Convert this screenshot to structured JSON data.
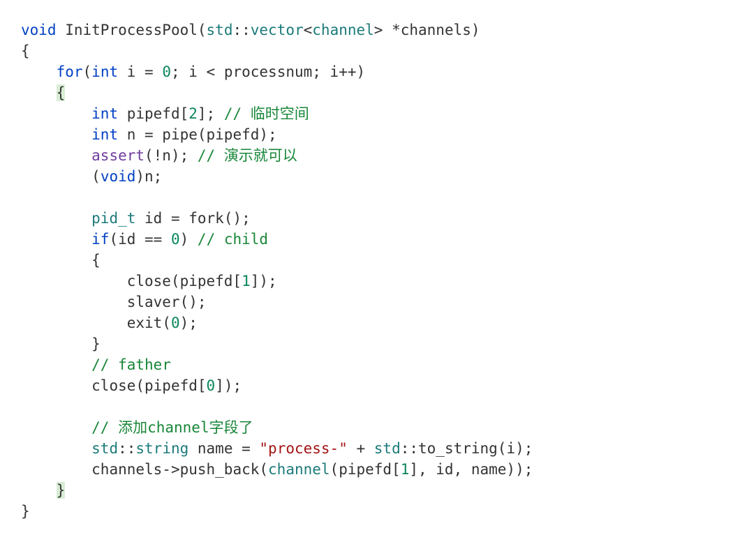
{
  "code": {
    "decl_void": "void",
    "decl_fn": " InitProcessPool",
    "decl_open": "(",
    "decl_std": "std",
    "decl_coloncolon1": "::",
    "decl_vector": "vector",
    "decl_lt": "<",
    "decl_channel": "channel",
    "decl_gt": ">",
    "decl_ptr": " *channels",
    "decl_close": ")",
    "brace_open_fn": "{",
    "for_kw": "for",
    "for_open": "(",
    "for_int": "int",
    "for_decl": " i = ",
    "for_zero": "0",
    "for_cond": "; i < processnum; i++",
    "for_close": ")",
    "brace_open_for": "{",
    "pipefd_int": "int",
    "pipefd_decl": " pipefd[",
    "pipefd_size": "2",
    "pipefd_end": "]; ",
    "pipefd_cmt": "// 临时空间",
    "npipe_int": "int",
    "npipe_rest": " n = pipe(pipefd);",
    "assert_fn": "assert",
    "assert_args": "(!n); ",
    "assert_cmt": "// 演示就可以",
    "castvoid_open": "(",
    "castvoid_kw": "void",
    "castvoid_rest": ")n;",
    "blank": "",
    "pidt": "pid_t",
    "pid_rest": " id = fork();",
    "if_kw": "if",
    "if_open": "(id == ",
    "if_zero": "0",
    "if_close": ") ",
    "if_cmt": "// child",
    "brace_open_if": "{",
    "child_close": "close(pipefd[",
    "child_close_idx": "1",
    "child_close_end": "]);",
    "child_slaver": "slaver();",
    "child_exit": "exit(",
    "child_exit_zero": "0",
    "child_exit_end": ");",
    "brace_close_if": "}",
    "father_cmt": "// father",
    "father_close": "close(pipefd[",
    "father_close_idx": "0",
    "father_close_end": "]);",
    "addch_cmt": "// 添加channel字段了",
    "name_std": "std",
    "name_cc": "::",
    "name_string": "string",
    "name_eq": " name = ",
    "name_str": "\"process-\"",
    "name_plus": " + ",
    "name_std2": "std",
    "name_cc2": "::",
    "name_tostr": "to_string(i);",
    "push_pre": "channels->push_back(",
    "push_channel": "channel",
    "push_open": "(pipefd[",
    "push_idx": "1",
    "push_rest": "], id, name));",
    "brace_close_for": "}",
    "brace_close_fn": "}"
  }
}
